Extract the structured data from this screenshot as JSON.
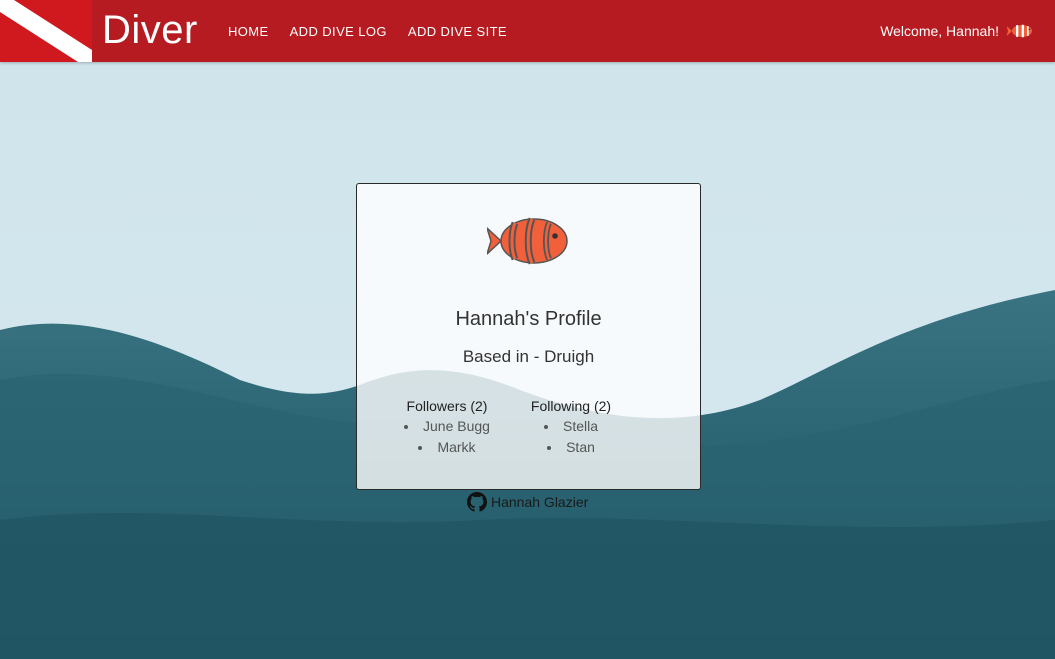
{
  "navbar": {
    "brand": "Diver",
    "links": [
      "HOME",
      "ADD DIVE LOG",
      "ADD DIVE SITE"
    ],
    "welcome": "Welcome, Hannah!",
    "icons": {
      "flag": "dive-flag-icon",
      "user": "clownfish-icon"
    }
  },
  "profile": {
    "title": "Hannah's Profile",
    "based_in": "Based in - Druigh",
    "followers": {
      "label": "Followers (2)",
      "names": [
        "June Bugg",
        "Markk"
      ]
    },
    "following": {
      "label": "Following (2)",
      "names": [
        "Stella",
        "Stan"
      ]
    }
  },
  "footer": {
    "author": "Hannah Glazier",
    "icon": "github-icon"
  },
  "colors": {
    "navbar": "#b51b20",
    "flag_red": "#d0181f",
    "fish_orange": "#f2603b"
  }
}
